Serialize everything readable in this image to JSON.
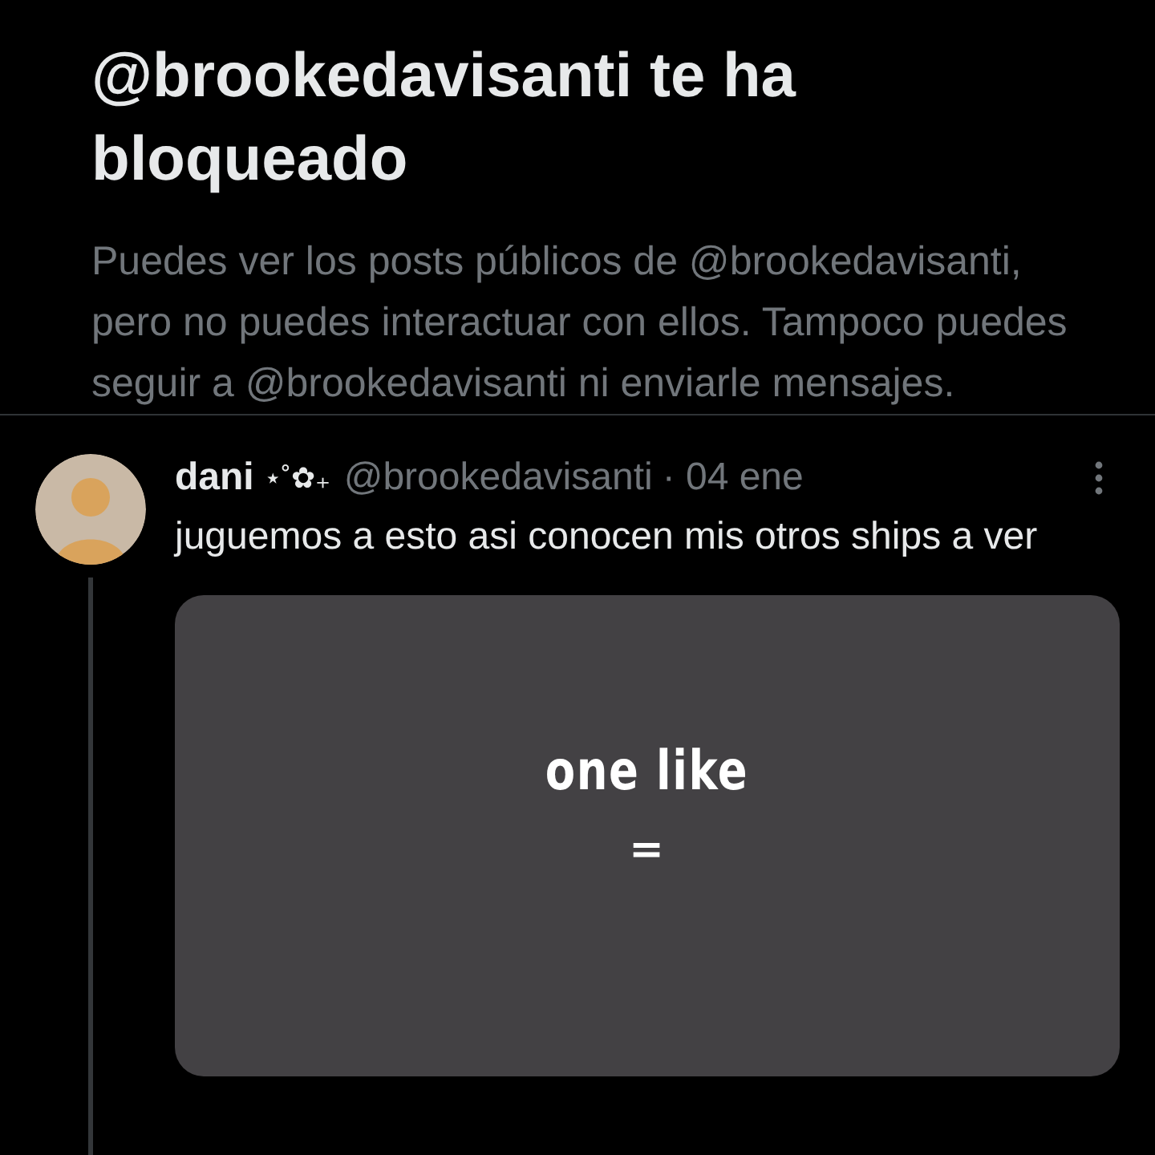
{
  "blocked_notice": {
    "title": "@brookedavisanti te ha bloqueado",
    "message": "Puedes ver los posts públicos de @brookedavisanti, pero no puedes interactuar con ellos. Tampoco puedes seguir a @brookedavisanti ni enviarle mensajes."
  },
  "post": {
    "display_name": "dani",
    "name_decoration": "⋆˚✿₊",
    "handle": "@brookedavisanti",
    "date": "· 04 ene",
    "text": "juguemos a esto asi conocen mis otros ships a ver",
    "media": {
      "lines": [
        "one like",
        "="
      ]
    }
  }
}
